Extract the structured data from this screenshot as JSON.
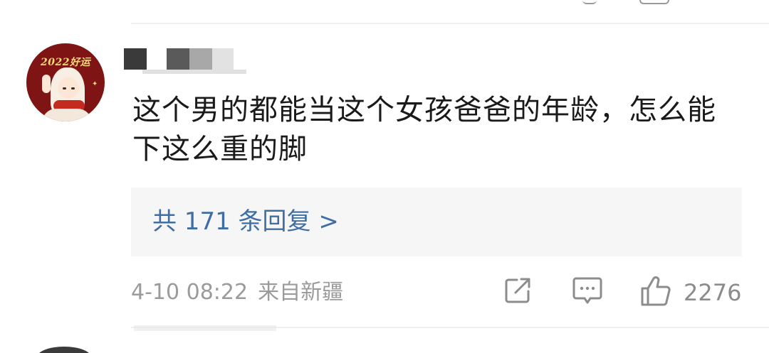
{
  "comment": {
    "text": "这个男的都能当这个女孩爸爸的年龄，怎么能下这么重的脚",
    "replies_link": "共 171 条回复 >",
    "time": "4-10 08:22",
    "location": "来自新疆",
    "likes": "2276"
  },
  "avatar": {
    "badge_text": "2022好运"
  },
  "icons": {
    "share": "share-icon",
    "comment": "comment-icon",
    "like": "thumbs-up-icon"
  },
  "colors": {
    "link": "#3f6ea3",
    "meta": "#9b9b9b",
    "reply_bg": "#f6f6f6"
  }
}
